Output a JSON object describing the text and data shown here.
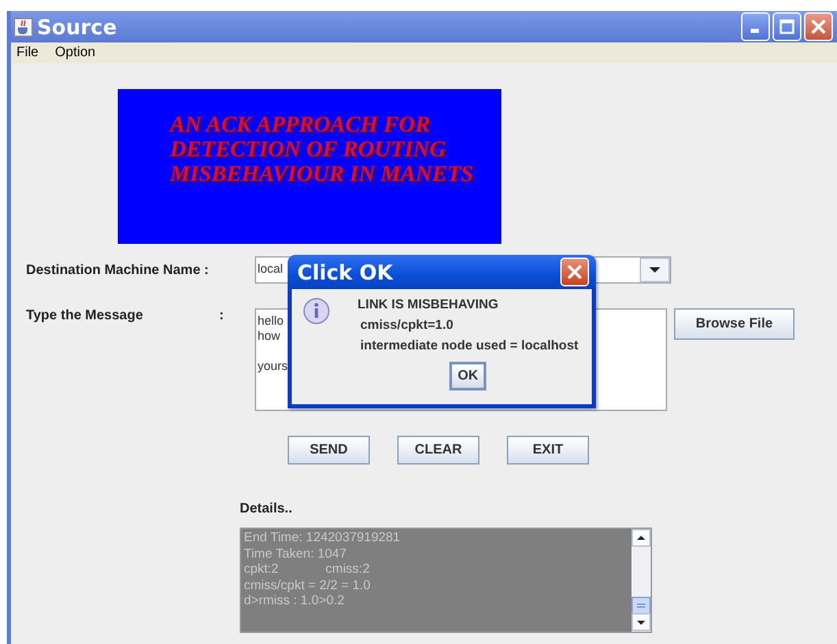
{
  "window": {
    "title": "Source"
  },
  "menu": [
    "File",
    "Option"
  ],
  "banner": {
    "lines": [
      "AN ACK APPROACH FOR",
      "DETECTION OF ROUTING",
      "MISBEHAVIOUR IN MANETS"
    ]
  },
  "destination": {
    "label": "Destination Machine Name :",
    "value": "local"
  },
  "message": {
    "label": "Type the Message",
    "colon": ":",
    "value": "hello\nhow\n\nyours"
  },
  "browse_button": "Browse File",
  "buttons": [
    "SEND",
    "CLEAR",
    "EXIT"
  ],
  "details": {
    "label": "Details..",
    "lines": [
      "End Time: 1242037919281",
      "Time Taken: 1047",
      "cpkt:2             cmiss:2",
      "cmiss/cpkt = 2/2 = 1.0",
      "d>rmiss : 1.0>0.2"
    ]
  },
  "dialog": {
    "title": "Click OK",
    "lines": [
      "LINK IS MISBEHAVING",
      "cmiss/cpkt=1.0",
      "intermediate node used = localhost"
    ],
    "button": "OK"
  }
}
